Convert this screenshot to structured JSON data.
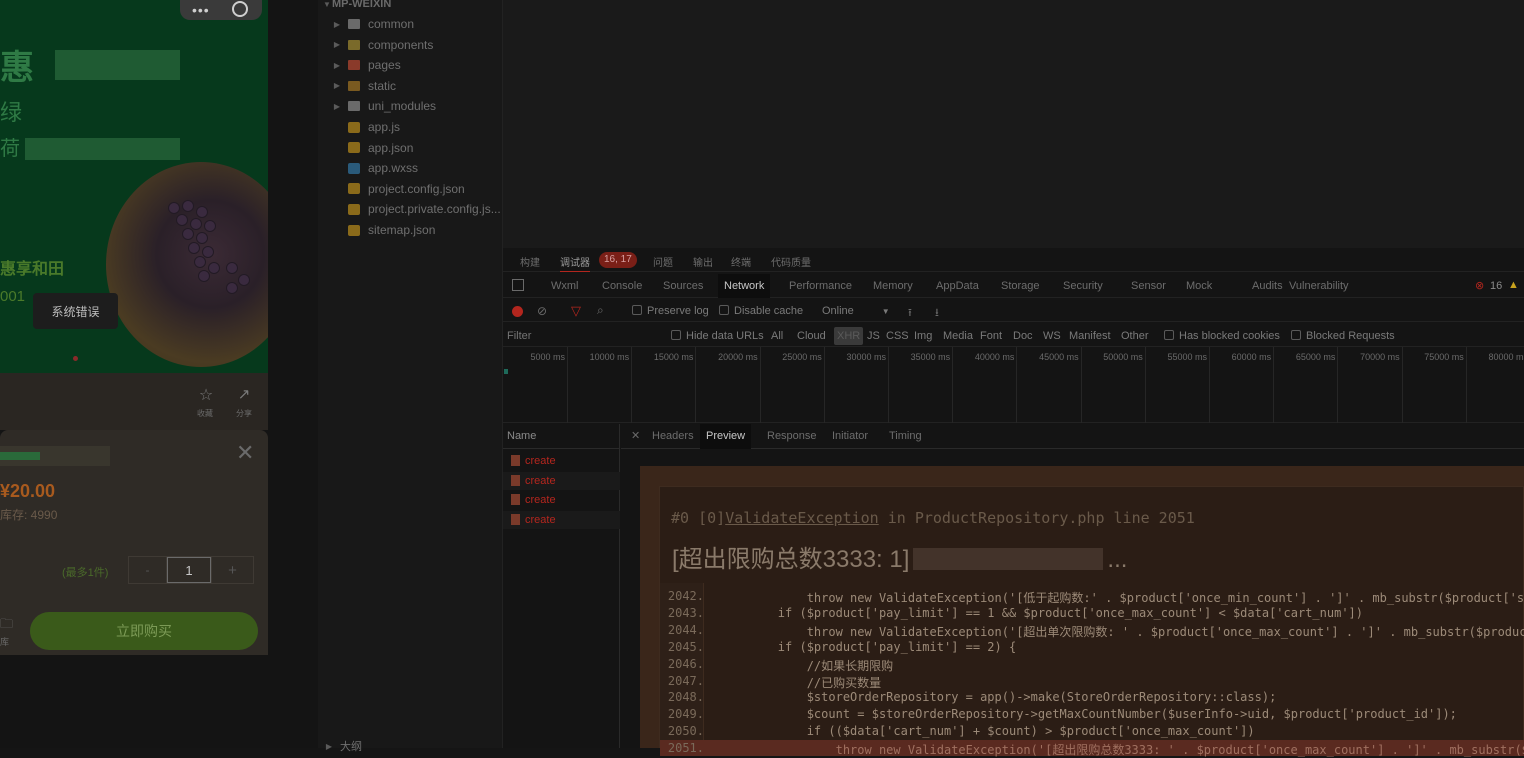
{
  "simulator": {
    "toast": "系统错误",
    "banner_text_1": "惠享和田",
    "banner_text_2": "001",
    "banner_glyph_1": "惠",
    "banner_glyph_2": "绿",
    "banner_glyph_3": "荷",
    "action_collect": "收藏",
    "action_share": "分享",
    "price": "20.00",
    "price_prefix": "¥",
    "stock": "库存: 4990",
    "limit_hint": "(最多1件)",
    "quantity": "1",
    "minus": "-",
    "plus": "+",
    "buy_button": "立即购买",
    "side_label": "库"
  },
  "file_tree": {
    "root": "MP-WEIXIN",
    "items": [
      {
        "label": "common",
        "type": "folder",
        "color": "#6a6a6a"
      },
      {
        "label": "components",
        "type": "folder",
        "color": "#7a6a2a"
      },
      {
        "label": "pages",
        "type": "folder",
        "color": "#8a3a2a"
      },
      {
        "label": "static",
        "type": "folder",
        "color": "#7a5a20"
      },
      {
        "label": "uni_modules",
        "type": "folder",
        "color": "#6a6a6a"
      },
      {
        "label": "app.js",
        "type": "js",
        "color": "#8a6a1a"
      },
      {
        "label": "app.json",
        "type": "json",
        "color": "#8a6a1a"
      },
      {
        "label": "app.wxss",
        "type": "wxss",
        "color": "#2a5a7a"
      },
      {
        "label": "project.config.json",
        "type": "json",
        "color": "#8a6a1a"
      },
      {
        "label": "project.private.config.js...",
        "type": "json",
        "color": "#8a6a1a"
      },
      {
        "label": "sitemap.json",
        "type": "json",
        "color": "#8a6a1a"
      }
    ],
    "footer": "大纲"
  },
  "panel_tabs": [
    {
      "label": "构建"
    },
    {
      "label": "调试器",
      "badge": "16, 17",
      "active": true
    },
    {
      "label": "问题"
    },
    {
      "label": "输出"
    },
    {
      "label": "终端"
    },
    {
      "label": "代码质量"
    }
  ],
  "devtools_tabs": [
    "Wxml",
    "Console",
    "Sources",
    "Network",
    "Performance",
    "Memory",
    "AppData",
    "Storage",
    "Security",
    "Sensor",
    "Mock",
    "Audits",
    "Vulnerability"
  ],
  "devtools_active_tab": "Network",
  "error_count": "16",
  "toolbar": {
    "preserve_log": "Preserve log",
    "disable_cache": "Disable cache",
    "throttle": "Online"
  },
  "filter_bar": {
    "placeholder": "Filter",
    "hide_data_urls": "Hide data URLs",
    "types": [
      "All",
      "Cloud",
      "XHR",
      "JS",
      "CSS",
      "Img",
      "Media",
      "Font",
      "Doc",
      "WS",
      "Manifest",
      "Other"
    ],
    "active_type": "XHR",
    "has_blocked_cookies": "Has blocked cookies",
    "blocked_requests": "Blocked Requests"
  },
  "timeline_ticks": [
    "5000 ms",
    "10000 ms",
    "15000 ms",
    "20000 ms",
    "25000 ms",
    "30000 ms",
    "35000 ms",
    "40000 ms",
    "45000 ms",
    "50000 ms",
    "55000 ms",
    "60000 ms",
    "65000 ms",
    "70000 ms",
    "75000 ms",
    "80000 ms"
  ],
  "requests": {
    "header": "Name",
    "rows": [
      "create",
      "create",
      "create",
      "create"
    ]
  },
  "detail_tabs": [
    "Headers",
    "Preview",
    "Response",
    "Initiator",
    "Timing"
  ],
  "detail_active_tab": "Preview",
  "preview": {
    "exception": "#0 [0]ValidateException in ProductRepository.php line 2051",
    "exception_prefix": "#0 [0]",
    "exception_class": "ValidateException",
    "exception_suffix": " in ProductRepository.php line 2051",
    "message": "[超出限购总数3333: 1]",
    "message_tail": "...",
    "lines": [
      {
        "no": "2042.",
        "code": "            throw new ValidateException('[低于起购数:' . $product['once_min_count'] . ']' . mb_substr($product['sto"
      },
      {
        "no": "2043.",
        "code": "        if ($product['pay_limit'] == 1 && $product['once_max_count'] < $data['cart_num'])"
      },
      {
        "no": "2044.",
        "code": "            throw new ValidateException('[超出单次限购数: ' . $product['once_max_count'] . ']' . mb_substr($product["
      },
      {
        "no": "2045.",
        "code": "        if ($product['pay_limit'] == 2) {"
      },
      {
        "no": "2046.",
        "code": "            //如果长期限购"
      },
      {
        "no": "2047.",
        "code": "            //已购买数量"
      },
      {
        "no": "2048.",
        "code": "            $storeOrderRepository = app()->make(StoreOrderRepository::class);"
      },
      {
        "no": "2049.",
        "code": "            $count = $storeOrderRepository->getMaxCountNumber($userInfo->uid, $product['product_id']);"
      },
      {
        "no": "2050.",
        "code": "            if (($data['cart_num'] + $count) > $product['once_max_count'])"
      },
      {
        "no": "2051.",
        "code": "                throw new ValidateException('[超出限购总数3333: ' . $product['once_max_count'] . ']' . mb_substr($p"
      }
    ]
  },
  "colors": {
    "accent_red": "#c0392b",
    "record_red": "#b3261e"
  }
}
